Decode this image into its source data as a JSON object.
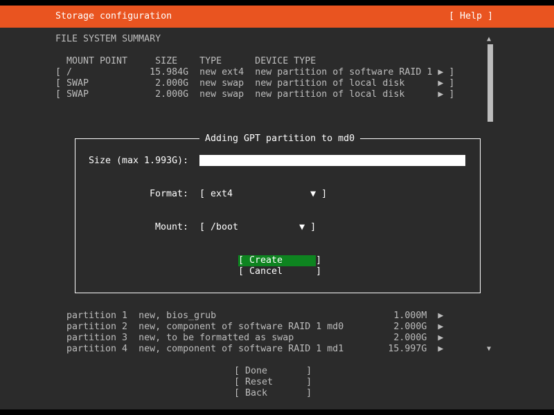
{
  "header": {
    "title": "Storage configuration",
    "help": "[ Help ]"
  },
  "summary": {
    "title": "FILE SYSTEM SUMMARY",
    "columns": "MOUNT POINT     SIZE    TYPE      DEVICE TYPE",
    "rows": [
      "[ /              15.984G  new ext4  new partition of software RAID 1 ▶ ]",
      "[ SWAP            2.000G  new swap  new partition of local disk      ▶ ]",
      "[ SWAP            2.000G  new swap  new partition of local disk      ▶ ]"
    ]
  },
  "scroll": {
    "up": "▲",
    "down": "▼"
  },
  "dialog": {
    "title": "Adding GPT partition to md0",
    "size_label": "Size (max 1.993G):",
    "size_value": "",
    "format_label": "Format:",
    "format_value": "[ ext4              ▼ ]",
    "mount_label": "Mount:",
    "mount_value": "[ /boot           ▼ ]",
    "create": "[ Create      ]",
    "cancel": "[ Cancel      ]"
  },
  "partitions": [
    "partition 1  new, bios_grub                                1.000M  ▶",
    "partition 2  new, component of software RAID 1 md0         2.000G  ▶",
    "partition 3  new, to be formatted as swap                  2.000G  ▶",
    "partition 4  new, component of software RAID 1 md1        15.997G  ▶"
  ],
  "actions": {
    "done": "[ Done       ]",
    "reset": "[ Reset      ]",
    "back": "[ Back       ]"
  }
}
